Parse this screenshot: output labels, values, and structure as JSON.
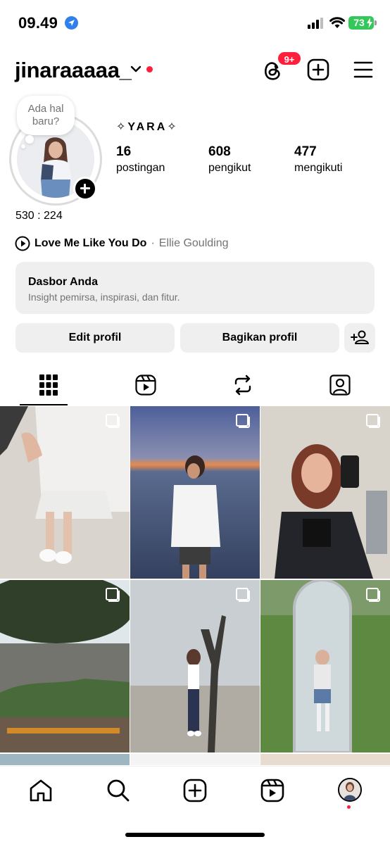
{
  "status": {
    "time": "09.49",
    "battery": "73"
  },
  "header": {
    "username": "jinaraaaaa_",
    "threads_badge": "9+"
  },
  "profile": {
    "note": "Ada hal baru?",
    "display_name": "✧YARA✧",
    "stats": [
      {
        "value": "16",
        "label": "postingan"
      },
      {
        "value": "608",
        "label": "pengikut"
      },
      {
        "value": "477",
        "label": "mengikuti"
      }
    ],
    "bio": "530 : 224",
    "music": {
      "title": "Love Me Like You Do",
      "separator": "·",
      "artist": "Ellie Goulding"
    }
  },
  "dashboard": {
    "title": "Dasbor Anda",
    "subtitle": "Insight pemirsa, inspirasi, dan fitur."
  },
  "buttons": {
    "edit": "Edit profil",
    "share": "Bagikan profil"
  },
  "tabs": [
    {
      "icon": "grid-icon",
      "active": true
    },
    {
      "icon": "reels-icon",
      "active": false
    },
    {
      "icon": "repost-icon",
      "active": false
    },
    {
      "icon": "tagged-icon",
      "active": false
    }
  ],
  "grid": {
    "posts": 9,
    "multi_indicator": true
  },
  "nav": [
    "home-icon",
    "search-icon",
    "create-icon",
    "reels-icon",
    "profile-avatar"
  ],
  "colors": {
    "accent_red": "#ff1f3d",
    "button_bg": "#efefef",
    "secondary_text": "#737373",
    "battery_green": "#34c759"
  }
}
